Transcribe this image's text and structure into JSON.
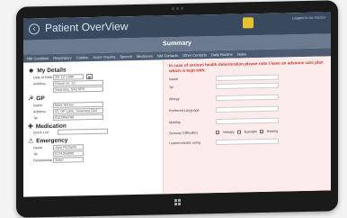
{
  "header": {
    "title": "Patient OverView",
    "login_info": "Logged in as: Doctor"
  },
  "summary_title": "Summary",
  "tabs": [
    "NM Condition",
    "Respiratory",
    "Cardiac",
    "Acute Trauma",
    "Speech",
    "Medicines",
    "NM Contacts",
    "Other Contacts",
    "Daily Routine",
    "Notes"
  ],
  "my_details": {
    "title": "My Details",
    "dob_label": "Date of Birth",
    "dob_value": "20/ 12/ 1980",
    "address_label": "Address",
    "address_line1": "House no. 22",
    "address_line2": "Swansea, SA2 8PP"
  },
  "gp": {
    "title": "GP",
    "name_label": "Name",
    "name_value": "Mark Nelson",
    "address_label": "Address",
    "address_value": "22, GP Lane, Swansea SA2",
    "tel_label": "Tel",
    "tel_value": "0123456789"
  },
  "medication": {
    "title": "Medication",
    "quick_list_label": "Quick List"
  },
  "emergency": {
    "title": "Emergency",
    "name_label": "Name",
    "name_value": "Jane Richards",
    "tel_label": "Tel",
    "tel_value": "0174356890",
    "relationship_label": "Relationship",
    "relationship_value": "Sister"
  },
  "right_panel": {
    "notice": "In case of serious health deterioration please note I have an advance care plan which is kept with:",
    "name_label": "Name",
    "tel_label": "Tel",
    "allergy_label": "Allergy",
    "preferred_language_label": "Preferred Language",
    "mobility_label": "Mobility",
    "sensory_label": "Sensory Difficulties",
    "sensory_options": [
      "Verbally",
      "Eyesight",
      "Hearing"
    ],
    "communicate_label": "I communicate using"
  }
}
